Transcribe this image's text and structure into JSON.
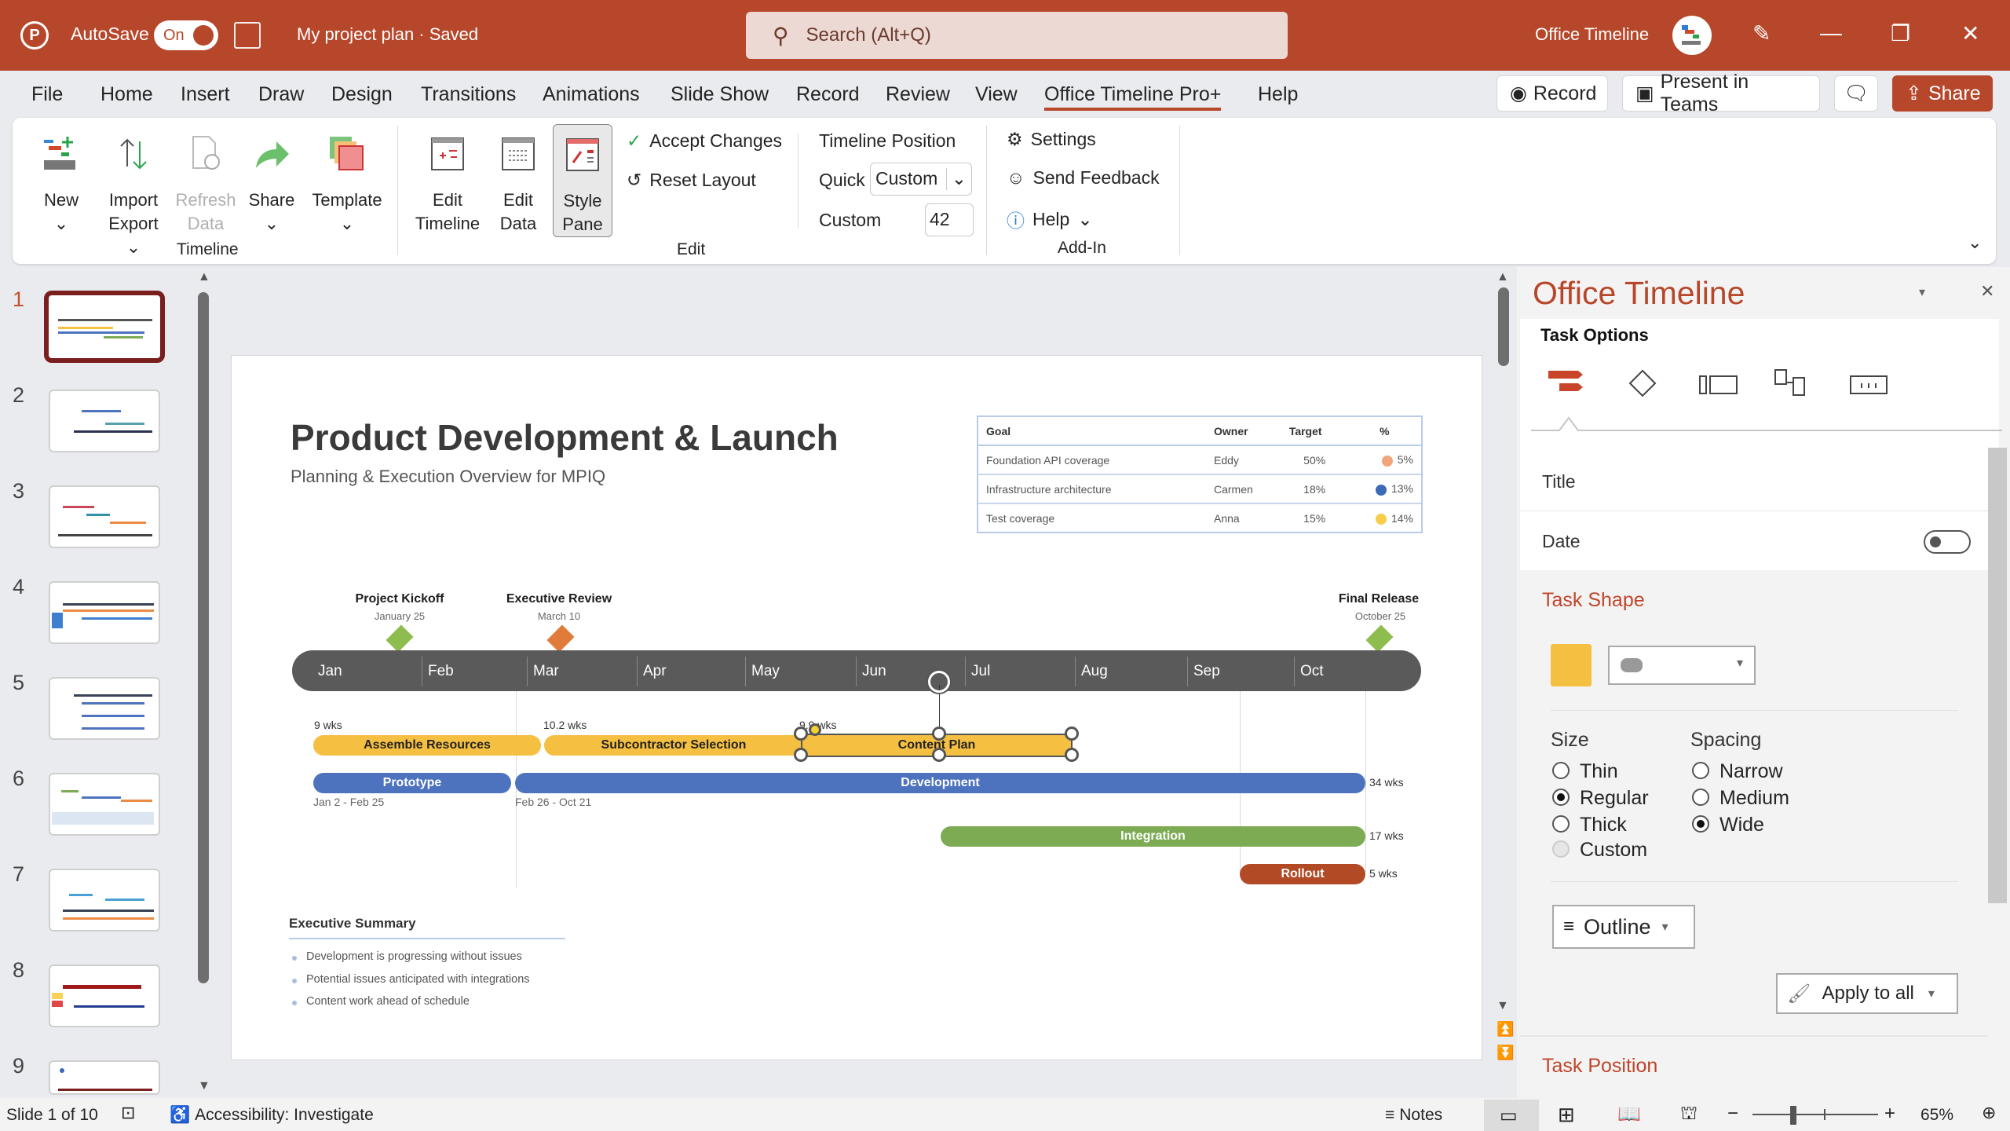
{
  "titlebar": {
    "app_icon": "powerpoint-icon",
    "autosave_label": "AutoSave",
    "autosave_state": "On",
    "document_title": "My project plan · Saved",
    "search_placeholder": "Search (Alt+Q)",
    "account_name": "Office Timeline",
    "window_controls": [
      "minimize",
      "restore",
      "close"
    ]
  },
  "menu": {
    "tabs": [
      "File",
      "Home",
      "Insert",
      "Draw",
      "Design",
      "Transitions",
      "Animations",
      "Slide Show",
      "Record",
      "Review",
      "View",
      "Office Timeline Pro+",
      "Help"
    ],
    "active_tab": "Office Timeline Pro+",
    "record_label": "Record",
    "present_label": "Present in Teams",
    "share_label": "Share"
  },
  "ribbon": {
    "timeline_group": {
      "label": "Timeline",
      "new": "New",
      "import_1": "Import",
      "import_2": "Export",
      "refresh_1": "Refresh",
      "refresh_2": "Data",
      "share": "Share",
      "template": "Template"
    },
    "edit_group": {
      "label": "Edit",
      "edit_timeline_1": "Edit",
      "edit_timeline_2": "Timeline",
      "edit_data_1": "Edit",
      "edit_data_2": "Data",
      "style_pane_1": "Style",
      "style_pane_2": "Pane",
      "accept_changes": "Accept Changes",
      "reset_layout": "Reset Layout",
      "timeline_position": "Timeline Position",
      "quick_label": "Quick",
      "quick_value": "Custom",
      "custom_label": "Custom",
      "custom_value": "42"
    },
    "addin_group": {
      "label": "Add-In",
      "settings": "Settings",
      "feedback": "Send Feedback",
      "help": "Help"
    }
  },
  "thumbnails": {
    "numbers": [
      "1",
      "2",
      "3",
      "4",
      "5",
      "6",
      "7",
      "8",
      "9"
    ],
    "current": 1
  },
  "slide": {
    "title": "Product Development & Launch",
    "subtitle": "Planning & Execution Overview for MPIQ",
    "goals": {
      "headers": [
        "Goal",
        "Owner",
        "Target",
        "%"
      ],
      "rows": [
        {
          "goal": "Foundation API coverage",
          "owner": "Eddy",
          "target": "50%",
          "pct": "5%",
          "color": "#f0a57a"
        },
        {
          "goal": "Infrastructure architecture",
          "owner": "Carmen",
          "target": "18%",
          "pct": "13%",
          "color": "#3d69b8"
        },
        {
          "goal": "Test coverage",
          "owner": "Anna",
          "target": "15%",
          "pct": "14%",
          "color": "#f7cd4b"
        }
      ]
    },
    "milestones": [
      {
        "title": "Project Kickoff",
        "date": "January 25",
        "color": "#8fbc4f"
      },
      {
        "title": "Executive Review",
        "date": "March 10",
        "color": "#e07b39"
      },
      {
        "title": "Final Release",
        "date": "October 25",
        "color": "#8fbc4f"
      }
    ],
    "months": [
      "Jan",
      "Feb",
      "Mar",
      "Apr",
      "May",
      "Jun",
      "Jul",
      "Aug",
      "Sep",
      "Oct"
    ],
    "tasks": [
      {
        "name": "Assemble Resources",
        "duration": "9 wks",
        "color": "#f5bf42"
      },
      {
        "name": "Subcontractor Selection",
        "duration": "10.2 wks",
        "color": "#f5bf42"
      },
      {
        "name": "Content Plan",
        "duration": "9.9 wks",
        "color": "#f5bf42"
      },
      {
        "name": "Prototype",
        "dates": "Jan 2 - Feb 25",
        "color": "#4e73be"
      },
      {
        "name": "Development",
        "dates": "Feb 26 - Oct 21",
        "duration": "34 wks",
        "color": "#4e73be"
      },
      {
        "name": "Integration",
        "duration": "17 wks",
        "color": "#7dab53"
      },
      {
        "name": "Rollout",
        "duration": "5 wks",
        "color": "#b24a26"
      }
    ],
    "summary": {
      "title": "Executive Summary",
      "items": [
        "Development is progressing without issues",
        "Potential issues anticipated with integrations",
        "Content work ahead of schedule"
      ]
    }
  },
  "pane": {
    "title": "Office Timeline",
    "section": "Task Options",
    "tabs": [
      "task-icon",
      "milestone-icon",
      "swimlane-icon",
      "dependency-icon",
      "scale-icon"
    ],
    "title_label": "Title",
    "date_label": "Date",
    "date_toggle": "off",
    "task_shape_heading": "Task Shape",
    "shape_color": "#f5bf42",
    "size_label": "Size",
    "size_options": [
      "Thin",
      "Regular",
      "Thick",
      "Custom"
    ],
    "size_selected": "Regular",
    "spacing_label": "Spacing",
    "spacing_options": [
      "Narrow",
      "Medium",
      "Wide"
    ],
    "spacing_selected": "Wide",
    "outline_label": "Outline",
    "apply_label": "Apply to all",
    "task_position_heading": "Task Position"
  },
  "statusbar": {
    "slide_info": "Slide 1 of 10",
    "accessibility": "Accessibility: Investigate",
    "notes": "Notes",
    "zoom": "65%",
    "zoom_fraction": 0.35
  }
}
